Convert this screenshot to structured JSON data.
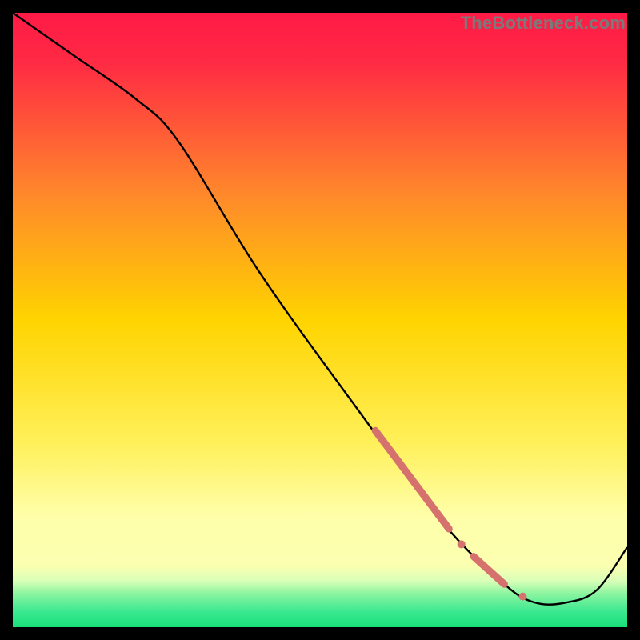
{
  "watermark": "TheBottleneck.com",
  "colors": {
    "top": "#ff1a46",
    "mid": "#ffd400",
    "pale": "#ffffaa",
    "green": "#19e07a",
    "line": "#000000",
    "marker": "#d6726e"
  },
  "chart_data": {
    "type": "line",
    "title": "",
    "xlabel": "",
    "ylabel": "",
    "xlim": [
      0,
      100
    ],
    "ylim": [
      0,
      100
    ],
    "grid": false,
    "legend": false,
    "series": [
      {
        "name": "curve",
        "x": [
          0,
          10,
          20,
          27,
          40,
          55,
          70,
          80,
          85,
          90,
          95,
          100
        ],
        "y": [
          100,
          93,
          86,
          79,
          58,
          37,
          17,
          7,
          4,
          4,
          6,
          13
        ]
      }
    ],
    "markers": [
      {
        "name": "band-1",
        "shape": "segment",
        "x": [
          59,
          71
        ],
        "y": [
          32,
          16
        ]
      },
      {
        "name": "dot-1",
        "shape": "dot",
        "x": 73,
        "y": 13.5
      },
      {
        "name": "band-2",
        "shape": "segment",
        "x": [
          75,
          80
        ],
        "y": [
          11.5,
          7
        ]
      },
      {
        "name": "dot-2",
        "shape": "dot",
        "x": 83,
        "y": 5
      }
    ],
    "background_bands_y": [
      {
        "from": 100,
        "to": 40,
        "gradient": [
          "#ff1a46",
          "#ffd400"
        ]
      },
      {
        "from": 40,
        "to": 18,
        "gradient": [
          "#ffd400",
          "#ffffaa"
        ]
      },
      {
        "from": 18,
        "to": 6,
        "gradient": [
          "#ffffaa",
          "#ffff80"
        ]
      },
      {
        "from": 6,
        "to": 0,
        "gradient": [
          "#5cf09a",
          "#19e07a"
        ]
      }
    ]
  }
}
